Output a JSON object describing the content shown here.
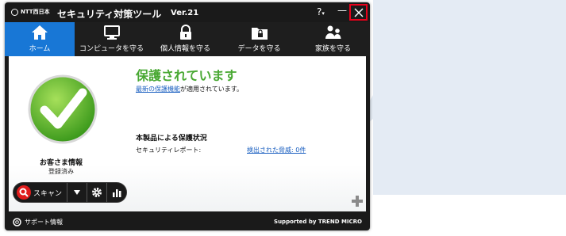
{
  "window": {
    "logo_text": "NTT西日本",
    "title": "セキュリティ対策ツール",
    "version": "Ver.21",
    "help_label": "?",
    "minimize_label": "—"
  },
  "nav": {
    "tabs": [
      {
        "label": "ホーム",
        "icon": "home-icon",
        "active": true
      },
      {
        "label": "コンピュータを守る",
        "icon": "monitor-icon",
        "active": false
      },
      {
        "label": "個人情報を守る",
        "icon": "lock-icon",
        "active": false
      },
      {
        "label": "データを守る",
        "icon": "folder-lock-icon",
        "active": false
      },
      {
        "label": "家族を守る",
        "icon": "family-icon",
        "active": false
      }
    ]
  },
  "status": {
    "title": "保護されています",
    "update_link": "最新の保護機能",
    "update_suffix": "が適用されています。",
    "section_heading": "本製品による保護状況",
    "report_label": "セキュリティレポート:",
    "threats_link": "検出された脅威: 0件"
  },
  "owner": {
    "label": "お客さま情報",
    "status": "登録済み"
  },
  "toolbar": {
    "scan_label": "スキャン"
  },
  "footer": {
    "support_label": "サポート情報",
    "supported_by": "Supported by TREND MICRO"
  },
  "colors": {
    "accent_blue": "#1877d6",
    "status_green": "#48a832",
    "close_highlight": "#e8001a",
    "scan_red": "#e01b1b"
  }
}
